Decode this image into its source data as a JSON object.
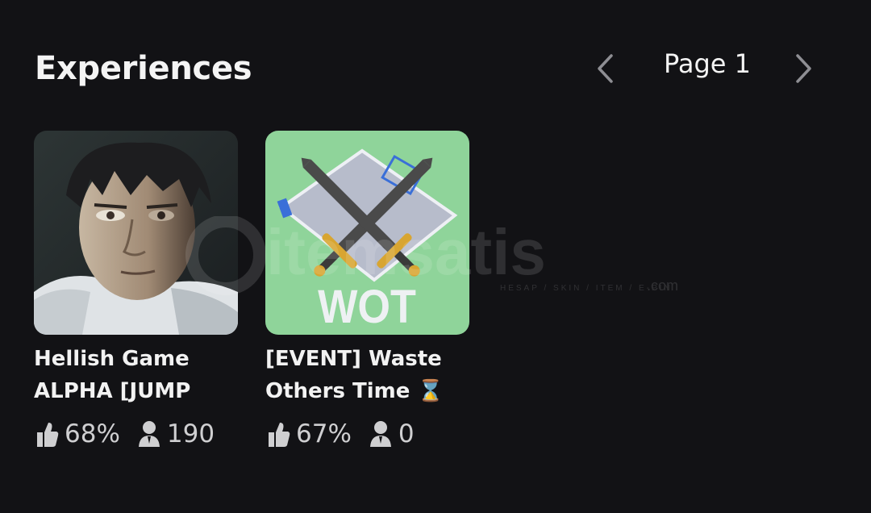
{
  "header": {
    "title": "Experiences",
    "page_label": "Page 1"
  },
  "experiences": [
    {
      "title_line1": "Hellish Game",
      "title_line2": "ALPHA [JUMP",
      "rating": "68%",
      "players": "190"
    },
    {
      "title_line1": "[EVENT] Waste",
      "title_line2": "Others Time",
      "title_emoji": "⌛",
      "thumb_text": "WOT",
      "rating": "67%",
      "players": "0"
    }
  ],
  "watermark": {
    "brand": "itemsatis",
    "tagline": "HESAP / SKIN / ITEM / E-PIN",
    "suffix": ".com"
  },
  "colors": {
    "background": "#121215",
    "text": "#f4f4f4",
    "muted": "#cfcfd1",
    "wot_thumb_bg": "#8fd49a"
  }
}
